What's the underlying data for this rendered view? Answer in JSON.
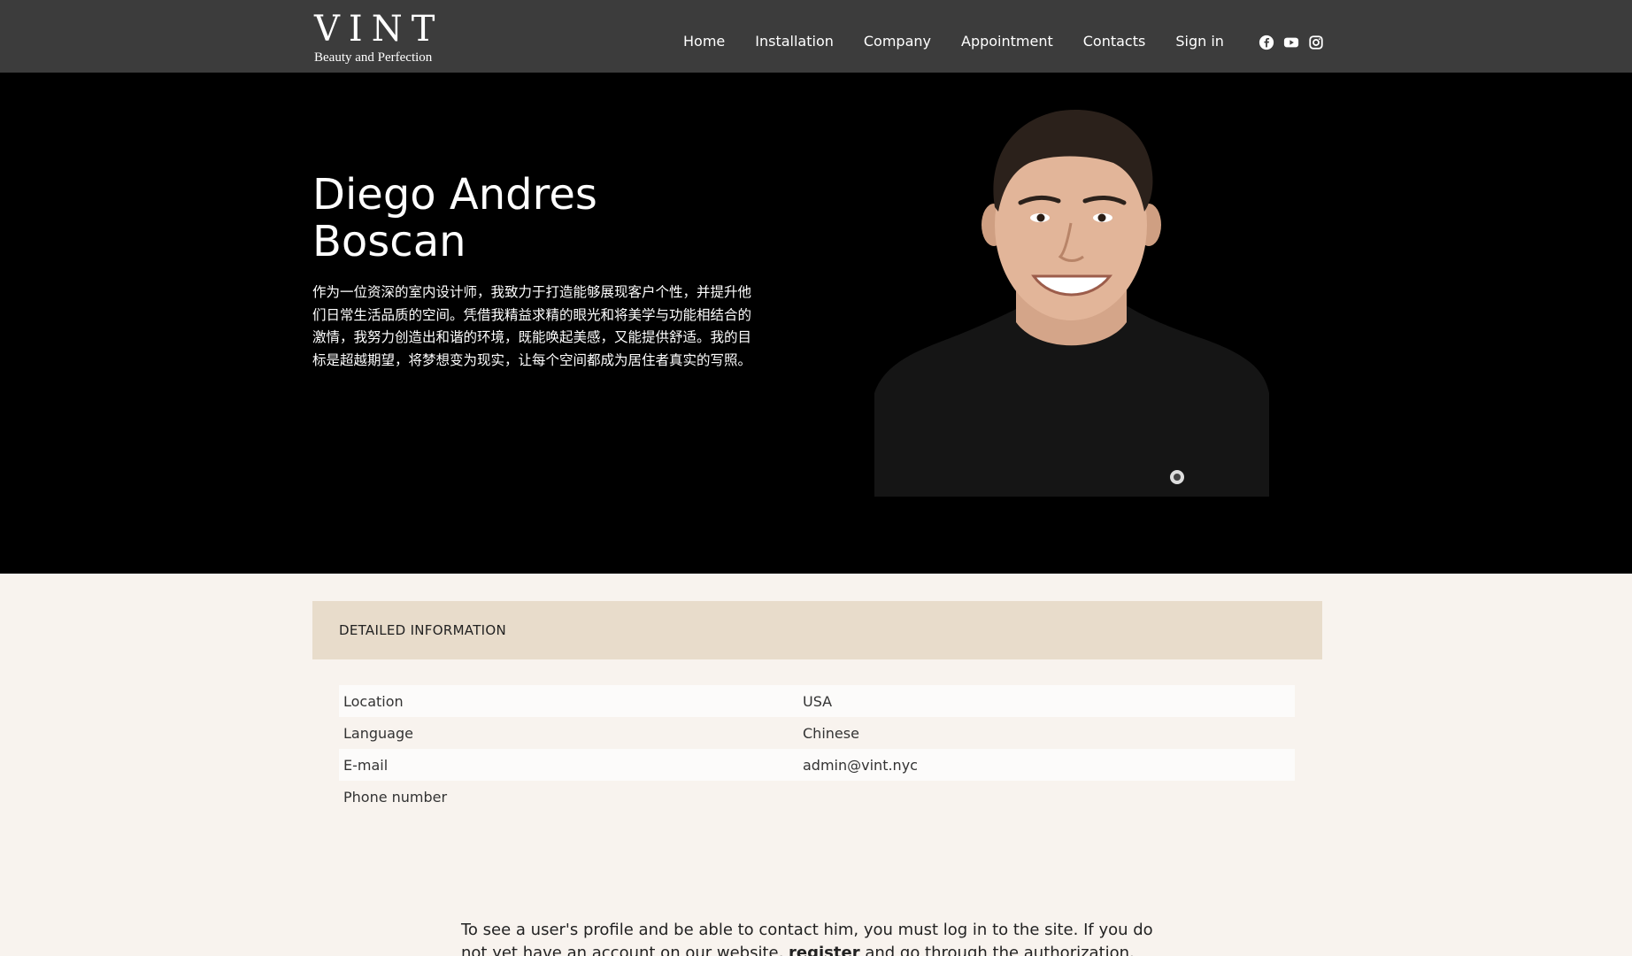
{
  "header": {
    "logo_word": "VINT",
    "logo_tagline": "Beauty and Perfection",
    "nav": [
      "Home",
      "Installation",
      "Company",
      "Appointment",
      "Contacts",
      "Sign in"
    ],
    "socials": [
      "facebook-icon",
      "youtube-icon",
      "instagram-icon"
    ]
  },
  "hero": {
    "name": "Diego Andres Boscan",
    "bio": "作为一位资深的室内设计师，我致力于打造能够展现客户个性，并提升他们日常生活品质的空间。凭借我精益求精的眼光和将美学与功能相结合的激情，我努力创造出和谐的环境，既能唤起美感，又能提供舒适。我的目标是超越期望，将梦想变为现实，让每个空间都成为居住者真实的写照。"
  },
  "details": {
    "title": "DETAILED INFORMATION",
    "rows": [
      {
        "label": "Location",
        "value": "USA"
      },
      {
        "label": "Language",
        "value": "Chinese"
      },
      {
        "label": "E-mail",
        "value": "admin@vint.nyc"
      },
      {
        "label": "Phone number",
        "value": ""
      }
    ]
  },
  "notice": {
    "before": "To see a user's profile and be able to contact him, you must log in to the site. If you do not yet have an account on our website, ",
    "link": "register",
    "after": " and go through the authorization."
  },
  "colors": {
    "header_bg": "#3c3c3c",
    "hero_bg": "#000000",
    "page_bg": "#f8f3ee",
    "details_header_bg": "#e8dccb"
  }
}
